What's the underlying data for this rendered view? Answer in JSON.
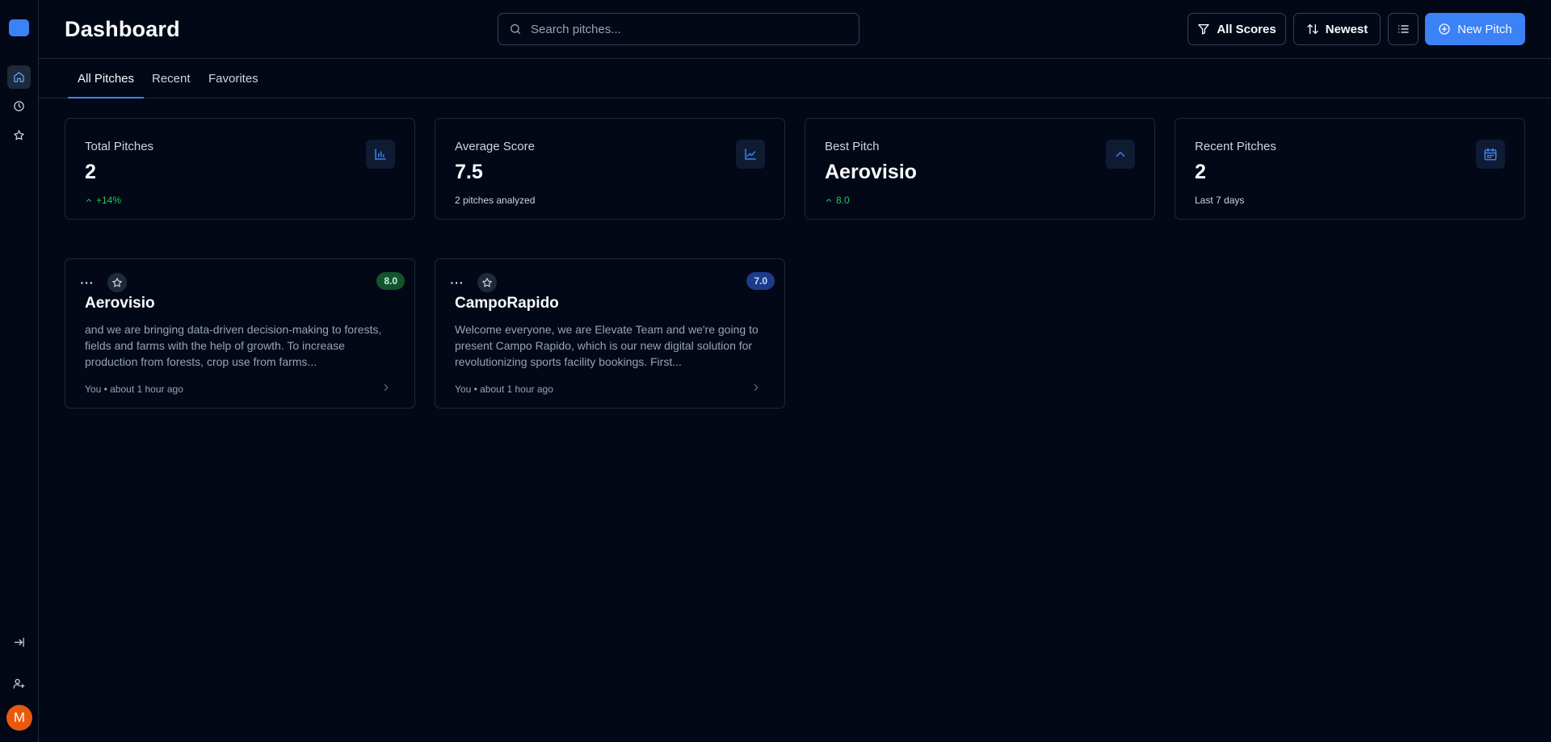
{
  "header": {
    "title": "Dashboard",
    "search_placeholder": "Search pitches...",
    "filter_label": "All Scores",
    "sort_label": "Newest",
    "new_pitch_label": "New Pitch"
  },
  "sidebar": {
    "avatar_initial": "M"
  },
  "tabs": [
    {
      "label": "All Pitches",
      "active": true
    },
    {
      "label": "Recent",
      "active": false
    },
    {
      "label": "Favorites",
      "active": false
    }
  ],
  "stats": [
    {
      "label": "Total Pitches",
      "value": "2",
      "sub": "+14%",
      "icon": "bar-chart-icon"
    },
    {
      "label": "Average Score",
      "value": "7.5",
      "sub": "2 pitches analyzed",
      "icon": "line-chart-icon"
    },
    {
      "label": "Best Pitch",
      "value": "Aerovisio",
      "sub": "8.0",
      "icon": "chevron-up-icon"
    },
    {
      "label": "Recent Pitches",
      "value": "2",
      "sub": "Last 7 days",
      "icon": "calendar-icon"
    }
  ],
  "pitches": [
    {
      "title": "Aerovisio",
      "score": "8.0",
      "description": "and we are bringing data-driven decision-making to forests, fields and farms with the help of growth. To increase production from forests, crop use from farms...",
      "meta": "You • about 1 hour ago",
      "more_label": "···"
    },
    {
      "title": "CampoRapido",
      "score": "7.0",
      "description": "Welcome everyone, we are Elevate Team and we're going to present Campo Rapido, which is our new digital solution for revolutionizing sports facility bookings. First...",
      "meta": "You • about 1 hour ago",
      "more_label": "···"
    }
  ],
  "colors": {
    "background": "#030817",
    "accent": "#3b82f6",
    "positive": "#22c55e",
    "avatar": "#ea580c"
  }
}
